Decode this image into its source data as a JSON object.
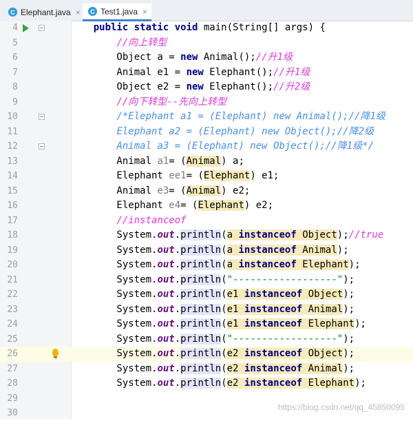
{
  "tabs": [
    {
      "label": "Elephant.java",
      "active": false
    },
    {
      "label": "Test1.java",
      "active": true
    }
  ],
  "tab_icon_letter": "C",
  "close_glyph": "×",
  "current_line": 26,
  "lines": [
    {
      "n": "4",
      "html": "    <span class='kw'>public static void</span> main(String[] args) {"
    },
    {
      "n": "5",
      "html": "        <span class='cm'>//向上转型</span>"
    },
    {
      "n": "6",
      "html": "        Object a = <span class='kw'>new</span> Animal();<span class='cm'>//升1级</span>"
    },
    {
      "n": "7",
      "html": "        Animal e1 = <span class='kw'>new</span> Elephant();<span class='cm'>//升1级</span>"
    },
    {
      "n": "8",
      "html": "        Object e2 = <span class='kw'>new</span> Elephant();<span class='cm'>//升2级</span>"
    },
    {
      "n": "9",
      "html": "        <span class='cm'>//向下转型--先向上转型</span>"
    },
    {
      "n": "10",
      "html": "        <span class='cmb'>/*Elephant a1 = (Elephant) new Animal();//降1级</span>"
    },
    {
      "n": "11",
      "html": "        <span class='cmb'>Elephant a2 = (Elephant) new Object();//降2级</span>"
    },
    {
      "n": "12",
      "html": "        <span class='cmb'>Animal a3 = (Elephant) new Object();//降1级*/</span>"
    },
    {
      "n": "13",
      "html": "        Animal <span class='unused'>a1</span>= (<span class='hl'>Animal</span>) a;"
    },
    {
      "n": "14",
      "html": "        Elephant <span class='unused'>ee1</span>= (<span class='hl'>Elephant</span>) e1;"
    },
    {
      "n": "15",
      "html": "        Animal <span class='unused'>e3</span>= (<span class='hl'>Animal</span>) e2;"
    },
    {
      "n": "16",
      "html": "        Elephant <span class='unused'>e4</span>= (<span class='hl'>Elephant</span>) e2;"
    },
    {
      "n": "17",
      "html": "        <span class='cm'>//instanceof</span>"
    },
    {
      "n": "18",
      "html": "        System.<span class='fld'>out</span>.<span class='hlp'>println</span>(<span class='hlv'>a <span class='kw'>instanceof</span> Object</span>);<span class='cm'>//true</span>"
    },
    {
      "n": "19",
      "html": "        System.<span class='fld'>out</span>.<span class='hlp'>println</span>(<span class='hlv'>a <span class='kw'>instanceof</span> Animal</span>);"
    },
    {
      "n": "20",
      "html": "        System.<span class='fld'>out</span>.<span class='hlp'>println</span>(<span class='hlv'>a <span class='kw'>instanceof</span> Elephant</span>);"
    },
    {
      "n": "21",
      "html": "        System.<span class='fld'>out</span>.<span class='hlp'>println</span>(<span class='str'>\"------------------\"</span>);"
    },
    {
      "n": "22",
      "html": "        System.<span class='fld'>out</span>.<span class='hlp'>println</span>(<span class='hlv'>e1 <span class='kw'>instanceof</span> Object</span>);"
    },
    {
      "n": "23",
      "html": "        System.<span class='fld'>out</span>.<span class='hlp'>println</span>(<span class='hlv'>e1 <span class='kw'>instanceof</span> Animal</span>);"
    },
    {
      "n": "24",
      "html": "        System.<span class='fld'>out</span>.<span class='hlp'>println</span>(<span class='hlv'>e1 <span class='kw'>instanceof</span> Elephant</span>);"
    },
    {
      "n": "25",
      "html": "        System.<span class='fld'>out</span>.<span class='hlp'>println</span>(<span class='str'>\"------------------\"</span>);"
    },
    {
      "n": "26",
      "html": "        System.<span class='fld'>out</span>.<span class='hlp'>println</span>(<span class='hlv'>e2 <span class='kw'>instanceof</span> Object</span>);"
    },
    {
      "n": "27",
      "html": "        System.<span class='fld'>out</span>.<span class='hlp'>println</span>(<span class='hlv'>e2 <span class='kw'>instanceof</span> Animal</span>);"
    },
    {
      "n": "28",
      "html": "        System.<span class='fld'>out</span>.<span class='hlp'>println</span>(<span class='hlv'>e2 <span class='kw'>instanceof</span> Elephant</span>);"
    },
    {
      "n": "29",
      "html": ""
    },
    {
      "n": "30",
      "html": ""
    }
  ],
  "watermark": "https://blog.csdn.net/qq_45850095"
}
